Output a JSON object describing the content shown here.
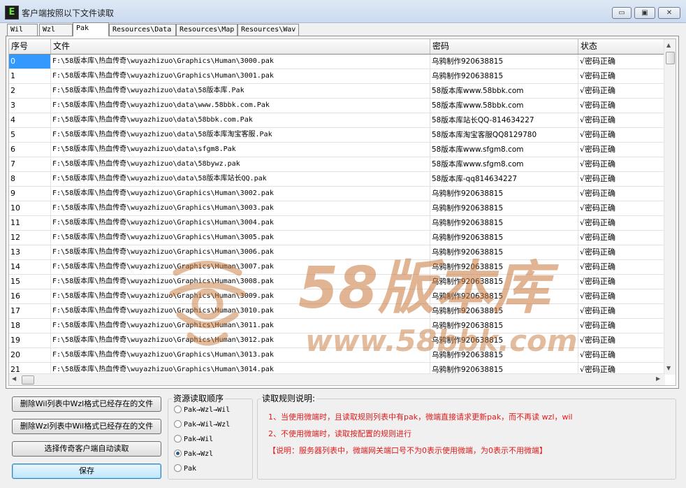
{
  "window": {
    "icon_letter": "E",
    "title": "客户端按照以下文件读取",
    "min_glyph": "▭",
    "max_glyph": "▣",
    "close_glyph": "✕"
  },
  "tabs": [
    {
      "label": "Wil",
      "active": false
    },
    {
      "label": "Wzl",
      "active": false
    },
    {
      "label": "Pak",
      "active": true
    },
    {
      "label": "Resources\\Data",
      "active": false
    },
    {
      "label": "Resources\\Map",
      "active": false
    },
    {
      "label": "Resources\\Wav",
      "active": false
    }
  ],
  "grid": {
    "columns": [
      "序号",
      "文件",
      "密码",
      "状态"
    ],
    "selected_row": 0,
    "rows": [
      [
        "0",
        "F:\\58版本库\\热血传奇\\wuyazhizuo\\Graphics\\Human\\3000.pak",
        "乌鸦制作920638815",
        "√密码正确"
      ],
      [
        "1",
        "F:\\58版本库\\热血传奇\\wuyazhizuo\\Graphics\\Human\\3001.pak",
        "乌鸦制作920638815",
        "√密码正确"
      ],
      [
        "2",
        "F:\\58版本库\\热血传奇\\wuyazhizuo\\data\\58版本库.Pak",
        "58版本库www.58bbk.com",
        "√密码正确"
      ],
      [
        "3",
        "F:\\58版本库\\热血传奇\\wuyazhizuo\\data\\www.58bbk.com.Pak",
        "58版本库www.58bbk.com",
        "√密码正确"
      ],
      [
        "4",
        "F:\\58版本库\\热血传奇\\wuyazhizuo\\data\\58bbk.com.Pak",
        "58版本库站长QQ-814634227",
        "√密码正确"
      ],
      [
        "5",
        "F:\\58版本库\\热血传奇\\wuyazhizuo\\data\\58版本库淘宝客服.Pak",
        "58版本库淘宝客服QQ8129780",
        "√密码正确"
      ],
      [
        "6",
        "F:\\58版本库\\热血传奇\\wuyazhizuo\\data\\sfgm8.Pak",
        "58版本库www.sfgm8.com",
        "√密码正确"
      ],
      [
        "7",
        "F:\\58版本库\\热血传奇\\wuyazhizuo\\data\\58bywz.pak",
        "58版本库www.sfgm8.com",
        "√密码正确"
      ],
      [
        "8",
        "F:\\58版本库\\热血传奇\\wuyazhizuo\\data\\58版本库站长QQ.pak",
        "58版本库-qq814634227",
        "√密码正确"
      ],
      [
        "9",
        "F:\\58版本库\\热血传奇\\wuyazhizuo\\Graphics\\Human\\3002.pak",
        "乌鸦制作920638815",
        "√密码正确"
      ],
      [
        "10",
        "F:\\58版本库\\热血传奇\\wuyazhizuo\\Graphics\\Human\\3003.pak",
        "乌鸦制作920638815",
        "√密码正确"
      ],
      [
        "11",
        "F:\\58版本库\\热血传奇\\wuyazhizuo\\Graphics\\Human\\3004.pak",
        "乌鸦制作920638815",
        "√密码正确"
      ],
      [
        "12",
        "F:\\58版本库\\热血传奇\\wuyazhizuo\\Graphics\\Human\\3005.pak",
        "乌鸦制作920638815",
        "√密码正确"
      ],
      [
        "13",
        "F:\\58版本库\\热血传奇\\wuyazhizuo\\Graphics\\Human\\3006.pak",
        "乌鸦制作920638815",
        "√密码正确"
      ],
      [
        "14",
        "F:\\58版本库\\热血传奇\\wuyazhizuo\\Graphics\\Human\\3007.pak",
        "乌鸦制作920638815",
        "√密码正确"
      ],
      [
        "15",
        "F:\\58版本库\\热血传奇\\wuyazhizuo\\Graphics\\Human\\3008.pak",
        "乌鸦制作920638815",
        "√密码正确"
      ],
      [
        "16",
        "F:\\58版本库\\热血传奇\\wuyazhizuo\\Graphics\\Human\\3009.pak",
        "乌鸦制作920638815",
        "√密码正确"
      ],
      [
        "17",
        "F:\\58版本库\\热血传奇\\wuyazhizuo\\Graphics\\Human\\3010.pak",
        "乌鸦制作920638815",
        "√密码正确"
      ],
      [
        "18",
        "F:\\58版本库\\热血传奇\\wuyazhizuo\\Graphics\\Human\\3011.pak",
        "乌鸦制作920638815",
        "√密码正确"
      ],
      [
        "19",
        "F:\\58版本库\\热血传奇\\wuyazhizuo\\Graphics\\Human\\3012.pak",
        "乌鸦制作920638815",
        "√密码正确"
      ],
      [
        "20",
        "F:\\58版本库\\热血传奇\\wuyazhizuo\\Graphics\\Human\\3013.pak",
        "乌鸦制作920638815",
        "√密码正确"
      ],
      [
        "21",
        "F:\\58版本库\\热血传奇\\wuyazhizuo\\Graphics\\Human\\3014.pak",
        "乌鸦制作920638815",
        "√密码正确"
      ]
    ],
    "scroll_up": "▲",
    "scroll_down": "▼",
    "scroll_left": "◀",
    "scroll_right": "▶"
  },
  "watermark": {
    "big": "58版本库",
    "url": "www.58bbk.com"
  },
  "actions": {
    "delete_wil_label": "删除Wil列表中Wzl格式已经存在的文件",
    "delete_wzl_label": "删除Wzl列表中Wil格式已经存在的文件",
    "auto_read_label": "选择传奇客户端自动读取",
    "save_label": "保存"
  },
  "resource_order": {
    "title": "资源读取顺序",
    "options": [
      {
        "label": "Pak→Wzl→Wil",
        "checked": false
      },
      {
        "label": "Pak→Wil→Wzl",
        "checked": false
      },
      {
        "label": "Pak→Wil",
        "checked": false
      },
      {
        "label": "Pak→Wzl",
        "checked": true
      },
      {
        "label": "Pak",
        "checked": false
      }
    ]
  },
  "rules": {
    "title": "读取规则说明:",
    "line1": "1、当使用微端时，且读取规则列表中有pak，微端直接请求更新pak，而不再读 wzl，wil",
    "line2": "2、不使用微端时，读取按配置的规则进行",
    "line3": "【说明：服务器列表中，微端网关端口号不为0表示使用微端，为0表示不用微端】",
    "text_color": "#e01b1b"
  }
}
